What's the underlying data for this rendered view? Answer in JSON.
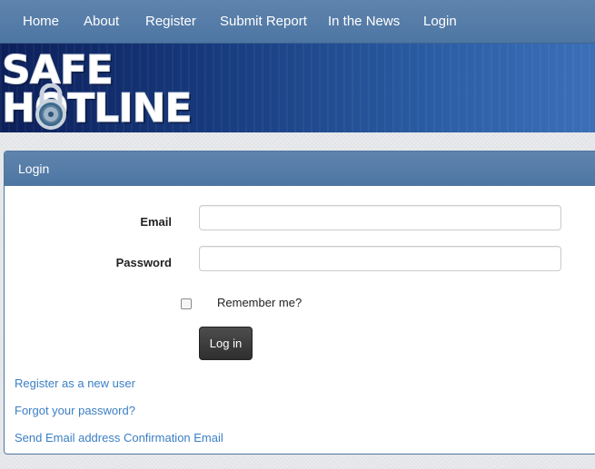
{
  "nav": {
    "items": [
      {
        "label": "Home"
      },
      {
        "label": "About"
      },
      {
        "label": "Register"
      },
      {
        "label": "Submit Report"
      },
      {
        "label": "In the News"
      },
      {
        "label": "Login"
      }
    ]
  },
  "banner": {
    "logo_line1": "SAFE",
    "logo_line2": "HOTLINE",
    "icon": "padlock-icon"
  },
  "login_panel": {
    "title": "Login",
    "email_label": "Email",
    "email_value": "",
    "password_label": "Password",
    "password_value": "",
    "remember_label": "Remember me?",
    "remember_checked": false,
    "submit_label": "Log in",
    "links": {
      "register": "Register as a new user",
      "forgot": "Forgot your password?",
      "confirm": "Send Email address Confirmation Email"
    }
  },
  "colors": {
    "nav_bg": "#5f84ad",
    "panel_border": "#4e76a3",
    "link": "#3b7fc4",
    "button_bg": "#333333"
  }
}
